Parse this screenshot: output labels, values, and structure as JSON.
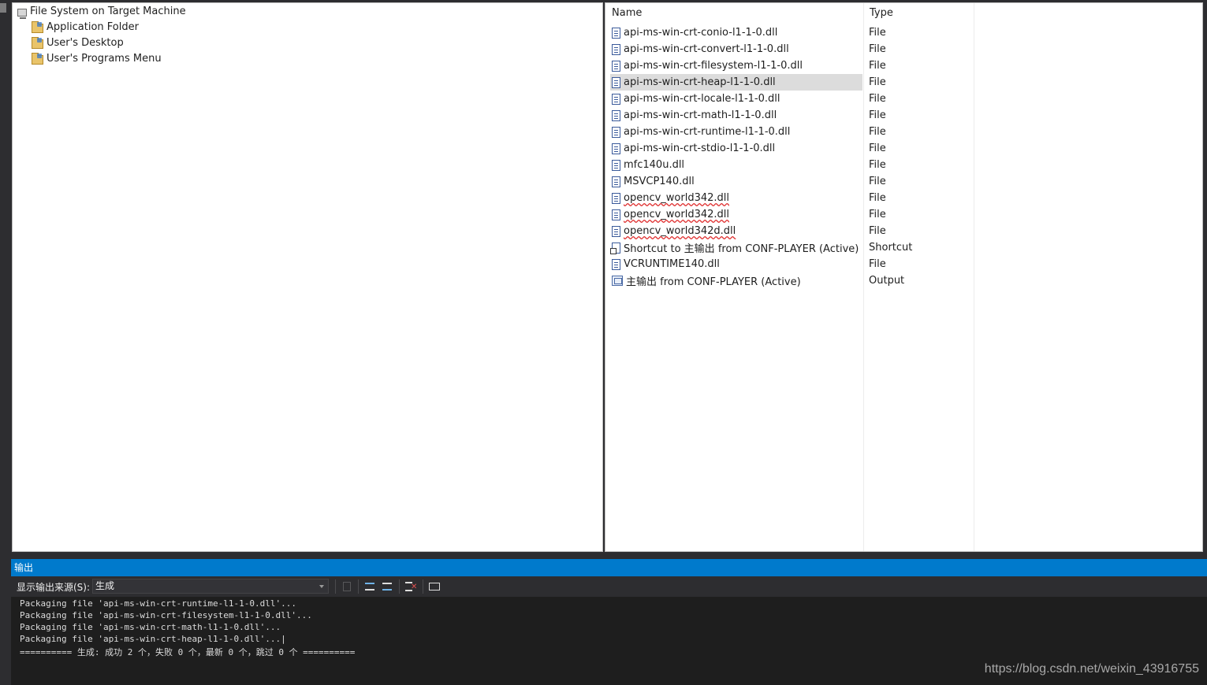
{
  "tree": {
    "root": "File System on Target Machine",
    "children": [
      "Application Folder",
      "User's Desktop",
      "User's Programs Menu"
    ]
  },
  "list": {
    "columns": {
      "name": "Name",
      "type": "Type"
    },
    "rows": [
      {
        "name": "api-ms-win-crt-conio-l1-1-0.dll",
        "type": "File",
        "icon": "file-icon"
      },
      {
        "name": "api-ms-win-crt-convert-l1-1-0.dll",
        "type": "File",
        "icon": "file-icon"
      },
      {
        "name": "api-ms-win-crt-filesystem-l1-1-0.dll",
        "type": "File",
        "icon": "file-icon"
      },
      {
        "name": "api-ms-win-crt-heap-l1-1-0.dll",
        "type": "File",
        "icon": "file-icon",
        "selected": true
      },
      {
        "name": "api-ms-win-crt-locale-l1-1-0.dll",
        "type": "File",
        "icon": "file-icon"
      },
      {
        "name": "api-ms-win-crt-math-l1-1-0.dll",
        "type": "File",
        "icon": "file-icon"
      },
      {
        "name": "api-ms-win-crt-runtime-l1-1-0.dll",
        "type": "File",
        "icon": "file-icon"
      },
      {
        "name": "api-ms-win-crt-stdio-l1-1-0.dll",
        "type": "File",
        "icon": "file-icon"
      },
      {
        "name": "mfc140u.dll",
        "type": "File",
        "icon": "file-icon"
      },
      {
        "name": "MSVCP140.dll",
        "type": "File",
        "icon": "file-icon"
      },
      {
        "name": "opencv_world342.dll",
        "type": "File",
        "icon": "file-icon",
        "warning": true
      },
      {
        "name": "opencv_world342.dll",
        "type": "File",
        "icon": "file-icon",
        "warning": true
      },
      {
        "name": "opencv_world342d.dll",
        "type": "File",
        "icon": "file-icon",
        "warning": true
      },
      {
        "name": "Shortcut to 主输出 from CONF-PLAYER (Active)",
        "type": "Shortcut",
        "icon": "shortcut-icon"
      },
      {
        "name": "VCRUNTIME140.dll",
        "type": "File",
        "icon": "file-icon"
      },
      {
        "name": "主输出 from CONF-PLAYER (Active)",
        "type": "Output",
        "icon": "output-icon"
      }
    ]
  },
  "output": {
    "title": "输出",
    "source_label": "显示输出来源(S):",
    "source_value": "生成",
    "lines": [
      "Packaging file 'api-ms-win-crt-runtime-l1-1-0.dll'...",
      "Packaging file 'api-ms-win-crt-filesystem-l1-1-0.dll'...",
      "Packaging file 'api-ms-win-crt-math-l1-1-0.dll'...",
      "Packaging file 'api-ms-win-crt-heap-l1-1-0.dll'...|",
      "========== 生成: 成功 2 个，失败 0 个，最新 0 个，跳过 0 个 =========="
    ]
  },
  "watermark": "https://blog.csdn.net/weixin_43916755",
  "colors": {
    "accent": "#007acc",
    "selection": "#dcdcdc",
    "warning": "#e03030"
  }
}
